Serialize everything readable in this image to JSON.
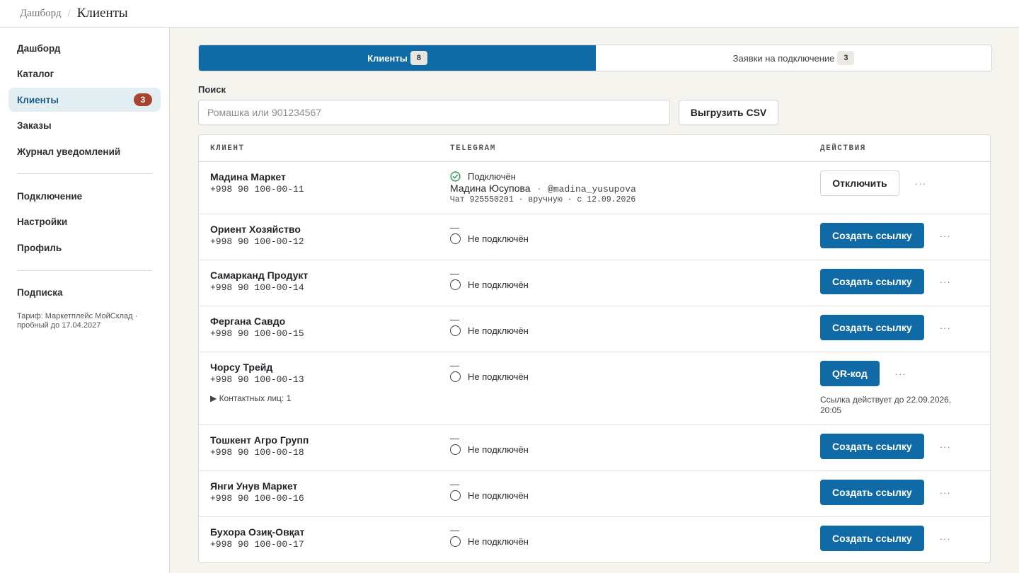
{
  "breadcrumb": {
    "root": "Дашборд",
    "separator": "/",
    "current": "Клиенты"
  },
  "sidebar": {
    "group1": [
      {
        "label": "Дашборд",
        "badge": ""
      },
      {
        "label": "Каталог",
        "badge": ""
      },
      {
        "label": "Клиенты",
        "badge": "3",
        "active": true
      },
      {
        "label": "Заказы",
        "badge": ""
      },
      {
        "label": "Журнал уведомлений",
        "badge": ""
      }
    ],
    "group2": [
      {
        "label": "Подключение"
      },
      {
        "label": "Настройки"
      },
      {
        "label": "Профиль"
      }
    ],
    "group3": [
      {
        "label": "Подписка"
      }
    ],
    "plan": "Тариф: Маркетплейс МойСклад · пробный до 17.04.2027"
  },
  "tabs": [
    {
      "label": "Клиенты",
      "count": "8",
      "active": true
    },
    {
      "label": "Заявки на подключение",
      "count": "3",
      "active": false
    }
  ],
  "search": {
    "label": "Поиск",
    "placeholder": "Ромашка или 901234567",
    "value": ""
  },
  "csv_button": "Выгрузить CSV",
  "table": {
    "headers": {
      "client": "КЛИЕНТ",
      "telegram": "TELEGRAM",
      "actions": "ДЕЙСТВИЯ"
    },
    "more_label": "···",
    "rows": [
      {
        "name": "Мадина Маркет",
        "phone": "+998 90 100-00-11",
        "tg_status": "Подключён",
        "tg_user": "Мадина Юсупова",
        "tg_sep": "·",
        "tg_handle": "@madina_yusupova",
        "tg_meta": "Чат 925550201 · вручную · с 12.09.2026",
        "action": "Отключить"
      },
      {
        "name": "Ориент Хозяйство",
        "phone": "+998 90 100-00-12",
        "tg_dash": "—",
        "tg_status": "Не подключён",
        "action": "Создать ссылку"
      },
      {
        "name": "Самарканд Продукт",
        "phone": "+998 90 100-00-14",
        "tg_dash": "—",
        "tg_status": "Не подключён",
        "action": "Создать ссылку"
      },
      {
        "name": "Фергана Савдо",
        "phone": "+998 90 100-00-15",
        "tg_dash": "—",
        "tg_status": "Не подключён",
        "action": "Создать ссылку"
      },
      {
        "name": "Чорсу Трейд",
        "phone": "+998 90 100-00-13",
        "contacts": "▶ Контактных лиц: 1",
        "tg_dash": "—",
        "tg_status": "Не подключён",
        "action": "QR-код",
        "link_note": "Ссылка действует до 22.09.2026, 20:05"
      },
      {
        "name": "Тошкент Агро Групп",
        "phone": "+998 90 100-00-18",
        "tg_dash": "—",
        "tg_status": "Не подключён",
        "action": "Создать ссылку"
      },
      {
        "name": "Янги Унув Маркет",
        "phone": "+998 90 100-00-16",
        "tg_dash": "—",
        "tg_status": "Не подключён",
        "action": "Создать ссылку"
      },
      {
        "name": "Бухора Озиқ-Овқат",
        "phone": "+998 90 100-00-17",
        "tg_dash": "—",
        "tg_status": "Не подключён",
        "action": "Создать ссылку"
      }
    ]
  },
  "colors": {
    "primary": "#106aa6",
    "badge": "#a8432d",
    "connected": "#2e9a5a",
    "active_nav_bg": "#e3eef3"
  }
}
